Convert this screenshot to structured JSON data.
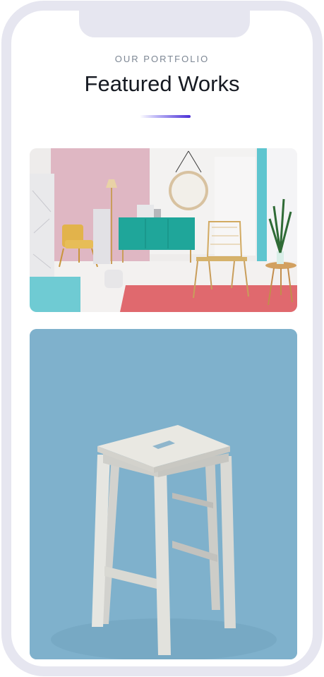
{
  "section": {
    "eyebrow": "OUR PORTFOLIO",
    "title": "Featured Works"
  },
  "colors": {
    "frame": "#e6e6f0",
    "accent_gradient_end": "#4b2fd6",
    "eyebrow_text": "#7d8794",
    "title_text": "#161a22"
  },
  "portfolio_items": [
    {
      "image": "pastel-living-room-photo"
    },
    {
      "image": "wooden-stool-on-blue-photo"
    }
  ]
}
